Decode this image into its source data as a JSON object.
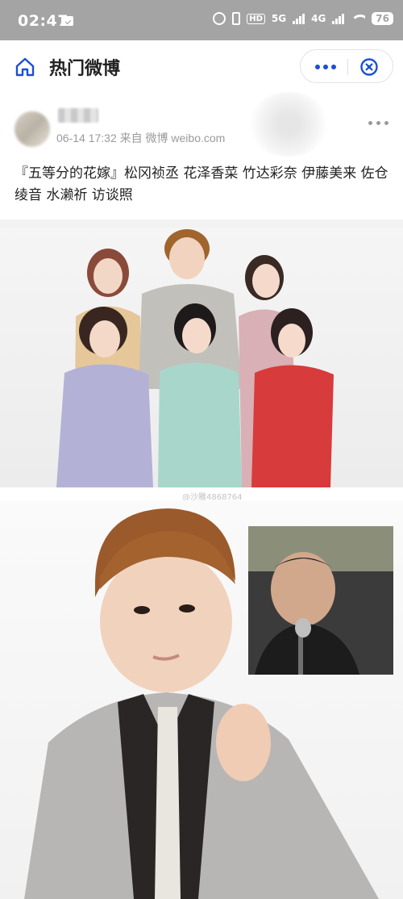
{
  "status_bar": {
    "time": "02:47",
    "network_hd": "HD",
    "network_5g": "5G",
    "network_4g": "4G",
    "battery": "76"
  },
  "header": {
    "title": "热门微博",
    "home_icon": "home-icon",
    "more_icon": "more-dots-icon",
    "close_icon": "close-circle-icon",
    "accent_color": "#1b4fd8"
  },
  "post": {
    "meta": "06-14 17:32 来自 微博 weibo.com",
    "text": "『五等分的花嫁』松冈祯丞 花泽香菜 竹达彩奈 伊藤美来 佐仓绫音 水濑祈 访谈照"
  },
  "media": {
    "watermark": "@沙雕4868764"
  }
}
